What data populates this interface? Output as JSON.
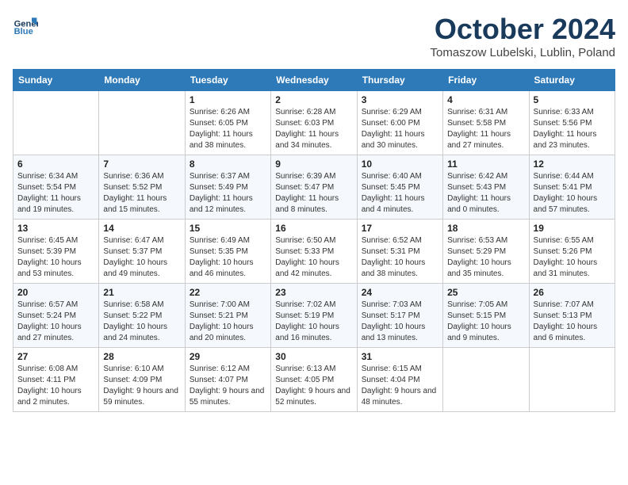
{
  "logo": {
    "line1": "General",
    "line2": "Blue"
  },
  "title": "October 2024",
  "subtitle": "Tomaszow Lubelski, Lublin, Poland",
  "headers": [
    "Sunday",
    "Monday",
    "Tuesday",
    "Wednesday",
    "Thursday",
    "Friday",
    "Saturday"
  ],
  "rows": [
    [
      {
        "day": "",
        "info": ""
      },
      {
        "day": "",
        "info": ""
      },
      {
        "day": "1",
        "info": "Sunrise: 6:26 AM\nSunset: 6:05 PM\nDaylight: 11 hours and 38 minutes."
      },
      {
        "day": "2",
        "info": "Sunrise: 6:28 AM\nSunset: 6:03 PM\nDaylight: 11 hours and 34 minutes."
      },
      {
        "day": "3",
        "info": "Sunrise: 6:29 AM\nSunset: 6:00 PM\nDaylight: 11 hours and 30 minutes."
      },
      {
        "day": "4",
        "info": "Sunrise: 6:31 AM\nSunset: 5:58 PM\nDaylight: 11 hours and 27 minutes."
      },
      {
        "day": "5",
        "info": "Sunrise: 6:33 AM\nSunset: 5:56 PM\nDaylight: 11 hours and 23 minutes."
      }
    ],
    [
      {
        "day": "6",
        "info": "Sunrise: 6:34 AM\nSunset: 5:54 PM\nDaylight: 11 hours and 19 minutes."
      },
      {
        "day": "7",
        "info": "Sunrise: 6:36 AM\nSunset: 5:52 PM\nDaylight: 11 hours and 15 minutes."
      },
      {
        "day": "8",
        "info": "Sunrise: 6:37 AM\nSunset: 5:49 PM\nDaylight: 11 hours and 12 minutes."
      },
      {
        "day": "9",
        "info": "Sunrise: 6:39 AM\nSunset: 5:47 PM\nDaylight: 11 hours and 8 minutes."
      },
      {
        "day": "10",
        "info": "Sunrise: 6:40 AM\nSunset: 5:45 PM\nDaylight: 11 hours and 4 minutes."
      },
      {
        "day": "11",
        "info": "Sunrise: 6:42 AM\nSunset: 5:43 PM\nDaylight: 11 hours and 0 minutes."
      },
      {
        "day": "12",
        "info": "Sunrise: 6:44 AM\nSunset: 5:41 PM\nDaylight: 10 hours and 57 minutes."
      }
    ],
    [
      {
        "day": "13",
        "info": "Sunrise: 6:45 AM\nSunset: 5:39 PM\nDaylight: 10 hours and 53 minutes."
      },
      {
        "day": "14",
        "info": "Sunrise: 6:47 AM\nSunset: 5:37 PM\nDaylight: 10 hours and 49 minutes."
      },
      {
        "day": "15",
        "info": "Sunrise: 6:49 AM\nSunset: 5:35 PM\nDaylight: 10 hours and 46 minutes."
      },
      {
        "day": "16",
        "info": "Sunrise: 6:50 AM\nSunset: 5:33 PM\nDaylight: 10 hours and 42 minutes."
      },
      {
        "day": "17",
        "info": "Sunrise: 6:52 AM\nSunset: 5:31 PM\nDaylight: 10 hours and 38 minutes."
      },
      {
        "day": "18",
        "info": "Sunrise: 6:53 AM\nSunset: 5:29 PM\nDaylight: 10 hours and 35 minutes."
      },
      {
        "day": "19",
        "info": "Sunrise: 6:55 AM\nSunset: 5:26 PM\nDaylight: 10 hours and 31 minutes."
      }
    ],
    [
      {
        "day": "20",
        "info": "Sunrise: 6:57 AM\nSunset: 5:24 PM\nDaylight: 10 hours and 27 minutes."
      },
      {
        "day": "21",
        "info": "Sunrise: 6:58 AM\nSunset: 5:22 PM\nDaylight: 10 hours and 24 minutes."
      },
      {
        "day": "22",
        "info": "Sunrise: 7:00 AM\nSunset: 5:21 PM\nDaylight: 10 hours and 20 minutes."
      },
      {
        "day": "23",
        "info": "Sunrise: 7:02 AM\nSunset: 5:19 PM\nDaylight: 10 hours and 16 minutes."
      },
      {
        "day": "24",
        "info": "Sunrise: 7:03 AM\nSunset: 5:17 PM\nDaylight: 10 hours and 13 minutes."
      },
      {
        "day": "25",
        "info": "Sunrise: 7:05 AM\nSunset: 5:15 PM\nDaylight: 10 hours and 9 minutes."
      },
      {
        "day": "26",
        "info": "Sunrise: 7:07 AM\nSunset: 5:13 PM\nDaylight: 10 hours and 6 minutes."
      }
    ],
    [
      {
        "day": "27",
        "info": "Sunrise: 6:08 AM\nSunset: 4:11 PM\nDaylight: 10 hours and 2 minutes."
      },
      {
        "day": "28",
        "info": "Sunrise: 6:10 AM\nSunset: 4:09 PM\nDaylight: 9 hours and 59 minutes."
      },
      {
        "day": "29",
        "info": "Sunrise: 6:12 AM\nSunset: 4:07 PM\nDaylight: 9 hours and 55 minutes."
      },
      {
        "day": "30",
        "info": "Sunrise: 6:13 AM\nSunset: 4:05 PM\nDaylight: 9 hours and 52 minutes."
      },
      {
        "day": "31",
        "info": "Sunrise: 6:15 AM\nSunset: 4:04 PM\nDaylight: 9 hours and 48 minutes."
      },
      {
        "day": "",
        "info": ""
      },
      {
        "day": "",
        "info": ""
      }
    ]
  ]
}
